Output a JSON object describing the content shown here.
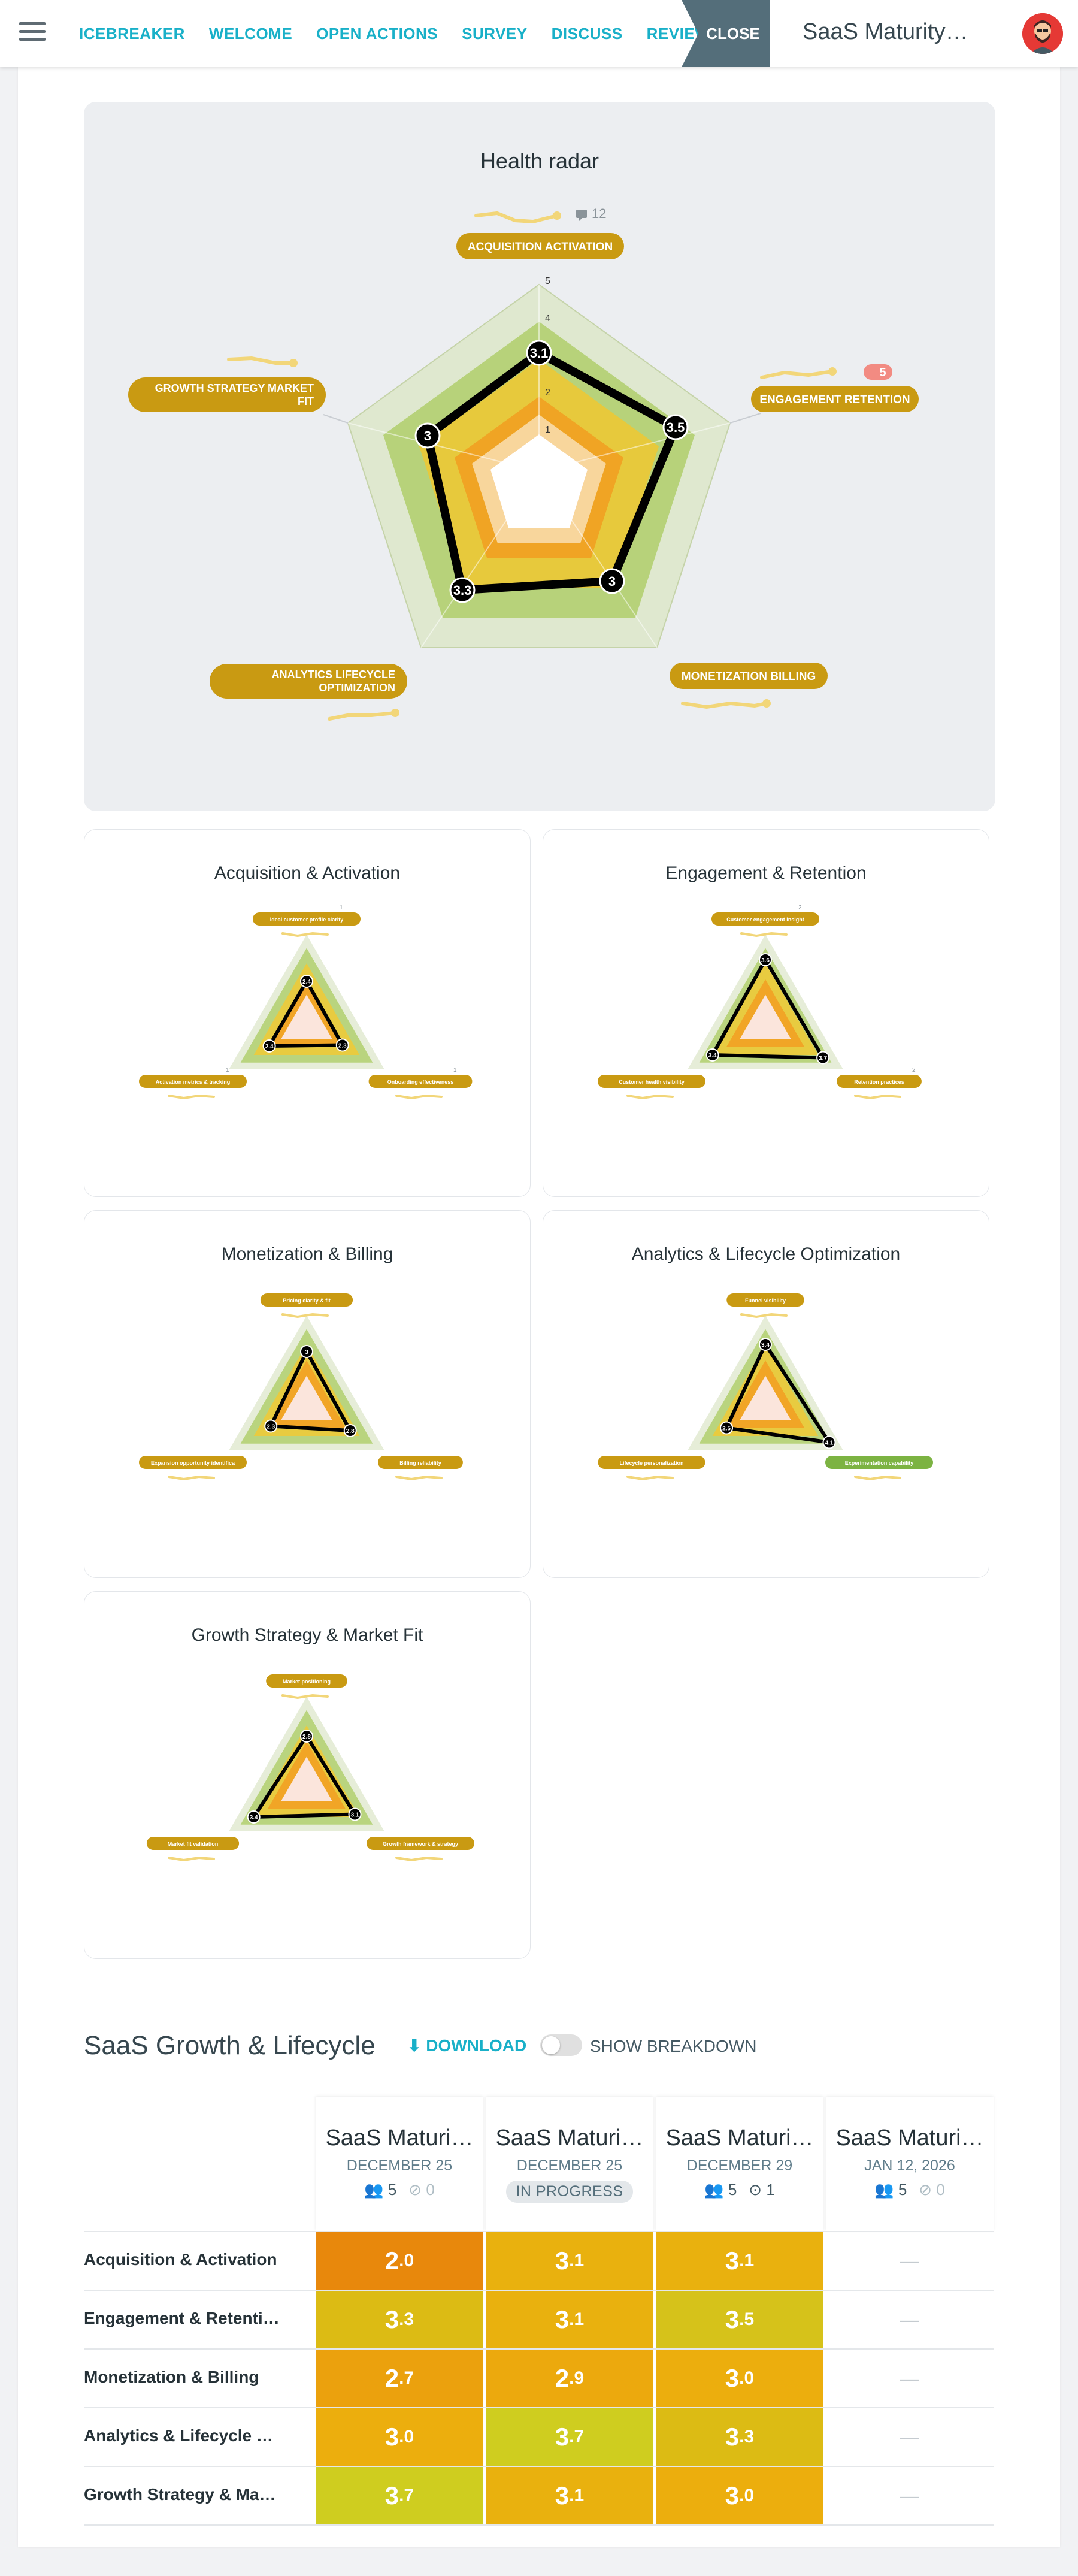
{
  "nav": {
    "items": [
      "ICEBREAKER",
      "WELCOME",
      "OPEN ACTIONS",
      "SURVEY",
      "DISCUSS",
      "REVIEW"
    ],
    "close_label": "CLOSE",
    "session_title": "SaaS Maturity…",
    "menu_icon": "hamburger-icon"
  },
  "health_radar": {
    "title": "Health radar",
    "comment_count": "12",
    "comment_badge": "5",
    "axes": [
      "ACQUISITION ACTIVATION",
      "ENGAGEMENT RETENTION",
      "MONETIZATION BILLING",
      "ANALYTICS LIFECYCLE OPTIMIZATION",
      "GROWTH STRATEGY MARKET FIT"
    ],
    "scale": [
      "1",
      "2",
      "3",
      "4",
      "5"
    ],
    "values": [
      "3.1",
      "3.5",
      "3",
      "3.3",
      "3"
    ]
  },
  "small_radars": [
    {
      "title": "Acquisition & Activation",
      "axes": [
        "Ideal customer profile clarity",
        "Onboarding effectiveness",
        "Activation metrics & tracking"
      ],
      "values": [
        "2.4",
        "2.3",
        "2.4"
      ],
      "comments": [
        "1",
        "1",
        "1"
      ]
    },
    {
      "title": "Engagement & Retention",
      "axes": [
        "Customer engagement insight",
        "Retention practices",
        "Customer health visibility"
      ],
      "values": [
        "3.6",
        "3.7",
        "3.4"
      ],
      "comments": [
        "2",
        "2"
      ]
    },
    {
      "title": "Monetization & Billing",
      "axes": [
        "Pricing clarity & fit",
        "Billing reliability",
        "Expansion opportunity identification"
      ],
      "values": [
        "3",
        "2.8",
        "2.3"
      ]
    },
    {
      "title": "Analytics & Lifecycle Optimization",
      "axes": [
        "Funnel visibility",
        "Experimentation capability",
        "Lifecycle personalization"
      ],
      "values": [
        "3.4",
        "4.1",
        "2.5"
      ]
    },
    {
      "title": "Growth Strategy & Market Fit",
      "axes": [
        "Market positioning",
        "Growth framework & strategy",
        "Market fit validation"
      ],
      "values": [
        "2.8",
        "3.1",
        "3.4"
      ]
    }
  ],
  "table": {
    "title": "SaaS Growth & Lifecycle",
    "download_label": "DOWNLOAD",
    "toggle_label": "SHOW BREAKDOWN",
    "columns": [
      {
        "title": "SaaS Maturi…",
        "date": "DECEMBER 25",
        "people": "5",
        "done": "0",
        "status": ""
      },
      {
        "title": "SaaS Maturi…",
        "date": "DECEMBER 25",
        "status": "IN PROGRESS"
      },
      {
        "title": "SaaS Maturi…",
        "date": "DECEMBER 29",
        "people": "5",
        "done": "1",
        "status": ""
      },
      {
        "title": "SaaS Maturi…",
        "date": "JAN 12, 2026",
        "people": "5",
        "done": "0",
        "status": ""
      }
    ],
    "rows": [
      {
        "label": "Acquisition & Activation",
        "values": [
          "2.0",
          "3.1",
          "3.1",
          "—"
        ],
        "colors": [
          "#e8880c",
          "#e9b10e",
          "#e9b10e",
          ""
        ]
      },
      {
        "label": "Engagement & Retenti…",
        "values": [
          "3.3",
          "3.1",
          "3.5",
          "—"
        ],
        "colors": [
          "#dcbb14",
          "#e9b10e",
          "#d6c21a",
          ""
        ]
      },
      {
        "label": "Monetization & Billing",
        "values": [
          "2.7",
          "2.9",
          "3.0",
          "—"
        ],
        "colors": [
          "#eba10d",
          "#eca90d",
          "#ecae0d",
          ""
        ]
      },
      {
        "label": "Analytics & Lifecycle …",
        "values": [
          "3.0",
          "3.7",
          "3.3",
          "—"
        ],
        "colors": [
          "#ecae0d",
          "#cfcd1f",
          "#dcbb14",
          ""
        ]
      },
      {
        "label": "Growth Strategy & Ma…",
        "values": [
          "3.7",
          "3.1",
          "3.0",
          "—"
        ],
        "colors": [
          "#cfcd1f",
          "#e9b10e",
          "#ecae0d",
          ""
        ]
      }
    ]
  },
  "colors": {
    "accent": "#19b0c8",
    "close_bg": "#546e7a",
    "label_gold": "#c99a12",
    "outline": "#000000"
  }
}
